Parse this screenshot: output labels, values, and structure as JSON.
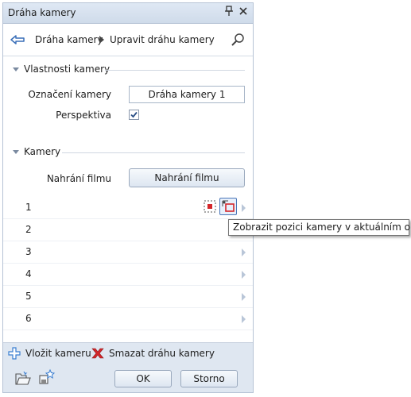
{
  "window": {
    "title": "Dráha kamery"
  },
  "breadcrumb": {
    "root": "Dráha kamery",
    "current": "Upravit dráhu kamery"
  },
  "sections": {
    "properties": {
      "title": "Vlastnosti kamery",
      "camera_label_caption": "Označení kamery",
      "camera_label_value": "Dráha kamery 1",
      "perspective_caption": "Perspektiva",
      "perspective_checked": true
    },
    "cameras": {
      "title": "Kamery",
      "record_caption": "Nahrání filmu",
      "record_button": "Nahrání filmu"
    }
  },
  "camera_rows": [
    "1",
    "2",
    "3",
    "4",
    "5",
    "6"
  ],
  "tooltip": "Zobrazit pozici kamery v aktuálním okně",
  "actions": {
    "add": "Vložit kameru",
    "delete": "Smazat dráhu kamery"
  },
  "footer": {
    "ok": "OK",
    "cancel": "Storno"
  },
  "icons": [
    "back-arrow-icon",
    "search-icon",
    "pin-icon",
    "close-icon",
    "focus-camera-icon",
    "show-camera-position-icon",
    "plus-icon",
    "delete-x-icon",
    "open-folder-icon",
    "save-favorite-icon"
  ],
  "colors": {
    "accent": "#4a76b8",
    "delete": "#d4262a",
    "add": "#3b7fd1",
    "toolbar_bg": "#dfe7f1"
  }
}
